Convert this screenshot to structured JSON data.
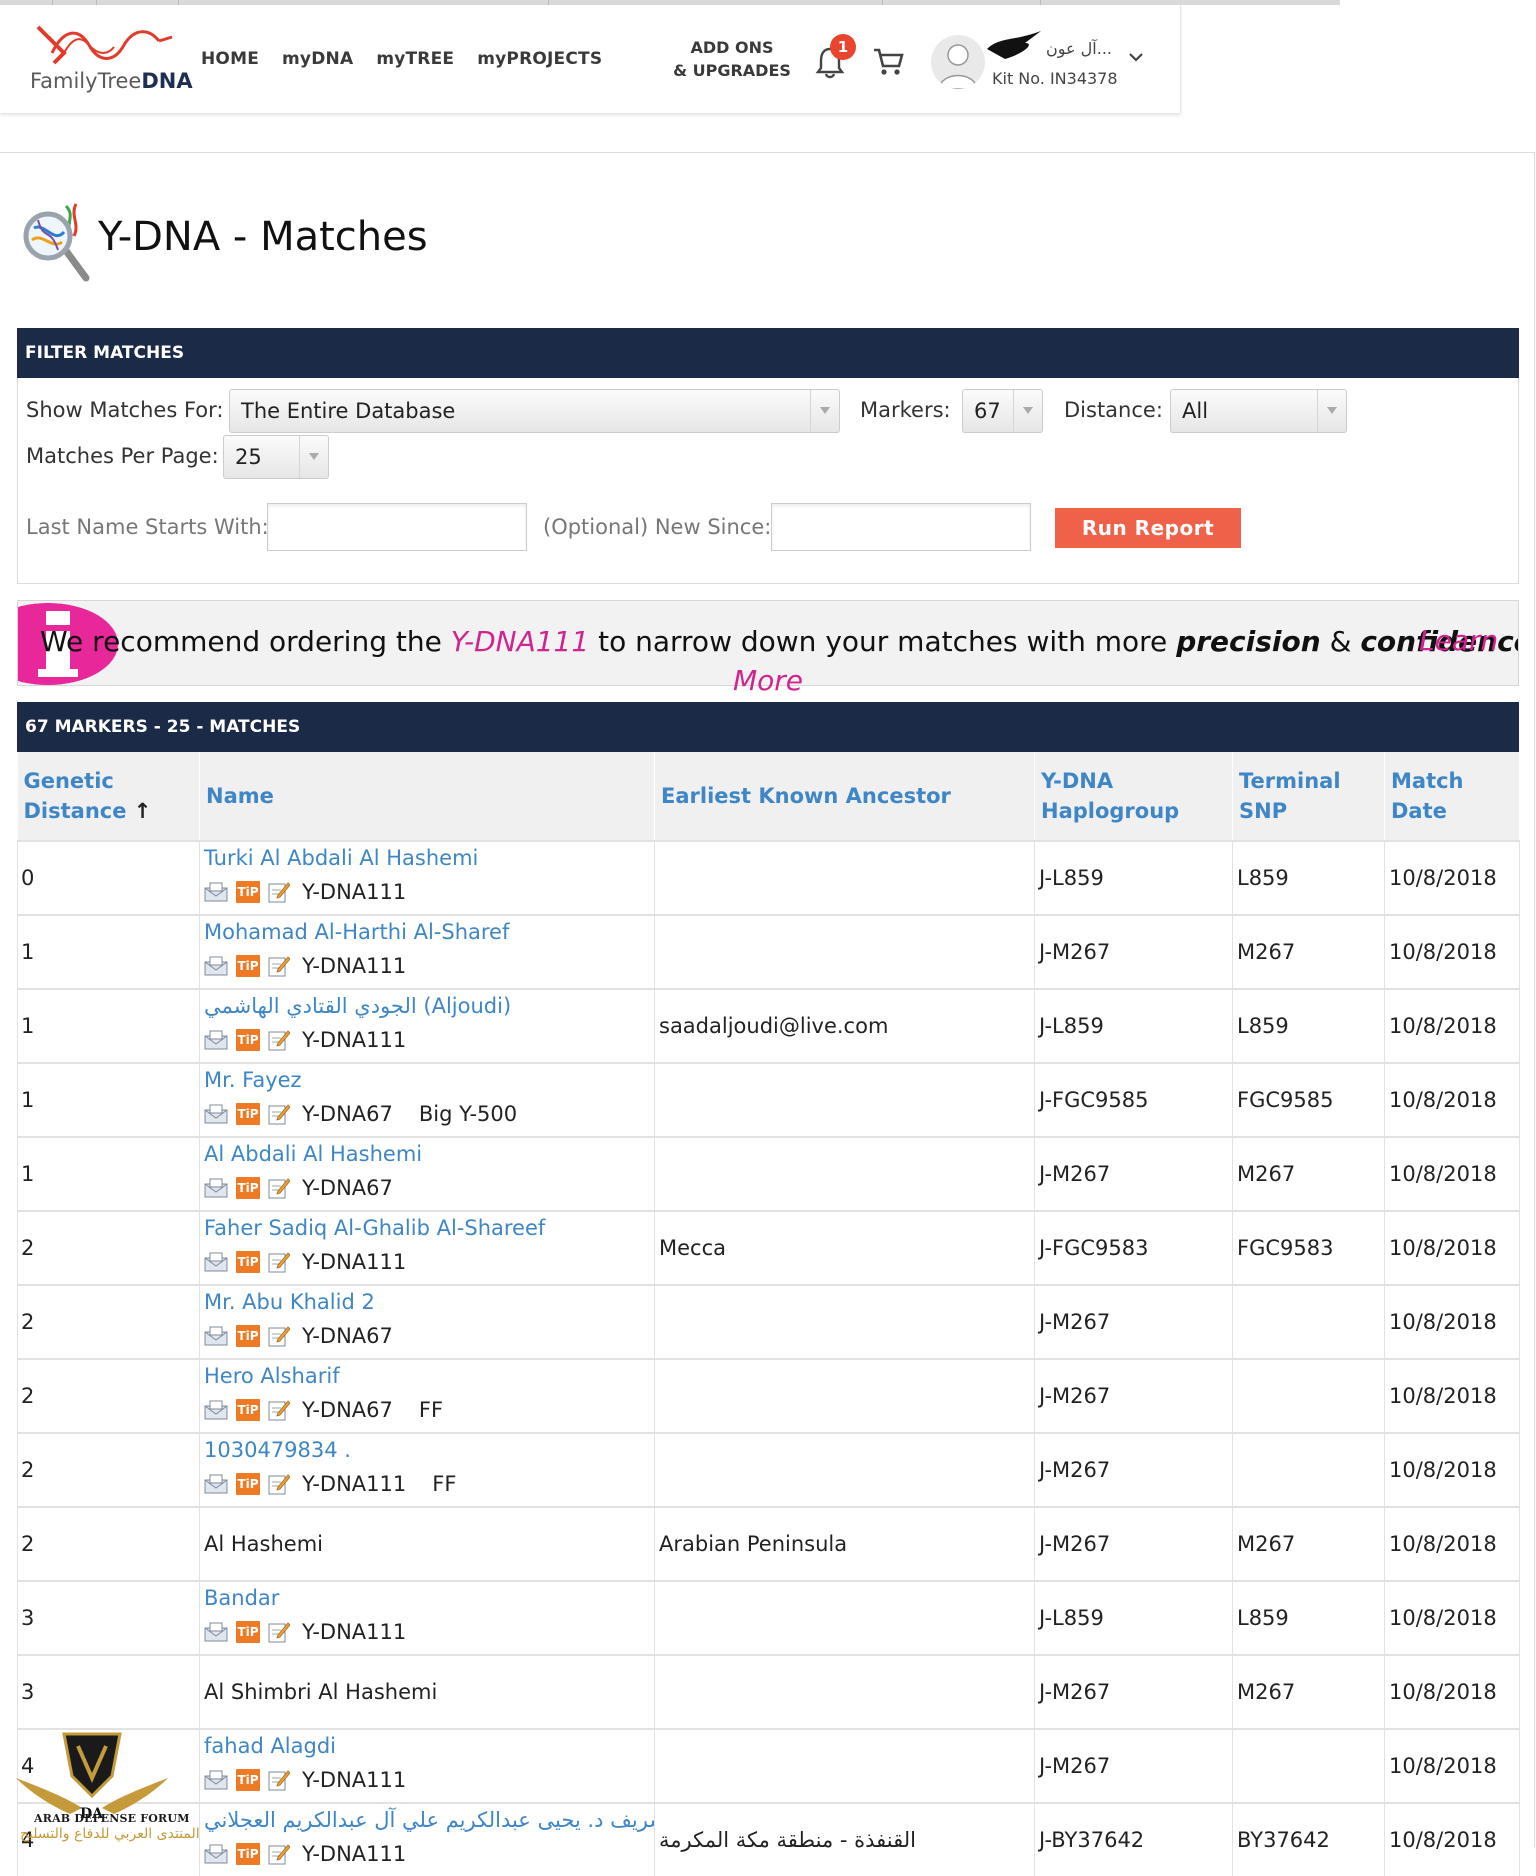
{
  "header": {
    "logo": {
      "word1": "FamilyTree",
      "word2": "DNA"
    },
    "nav": [
      "HOME",
      "myDNA",
      "myTREE",
      "myPROJECTS"
    ],
    "addons_line1": "ADD ONS",
    "addons_line2": "& UPGRADES",
    "notification_count": "1",
    "user_name": "...آل عون",
    "kit_number": "Kit No. IN34378"
  },
  "page": {
    "title": "Y-DNA - Matches"
  },
  "filter": {
    "heading": "FILTER MATCHES",
    "show_label": "Show Matches For:",
    "show_value": "The Entire Database",
    "markers_label": "Markers:",
    "markers_value": "67",
    "distance_label": "Distance:",
    "distance_value": "All",
    "per_page_label": "Matches Per Page:",
    "per_page_value": "25",
    "lastname_label": "Last Name Starts With:",
    "lastname_value": "",
    "newsince_label": "(Optional) New Since:",
    "newsince_value": "",
    "run_label": "Run Report"
  },
  "promo": {
    "t1": "We recommend ordering the ",
    "product": "Y-DNA111",
    "t2": " to narrow down your matches with more ",
    "w1": "precision",
    "t3": " & ",
    "w2": "confidence.",
    "learn1": "Learn",
    "learn2": "More"
  },
  "results": {
    "heading": "67 MARKERS - 25 - MATCHES",
    "headers": {
      "dist_line1": "Genetic",
      "dist_line2": "Distance",
      "sort_arrow": "↑",
      "name": "Name",
      "eka": "Earliest Known Ancestor",
      "hg_line1": "Y-DNA",
      "hg_line2": "Haplogroup",
      "snp_line1": "Terminal",
      "snp_line2": "SNP",
      "date": "Match Date"
    },
    "rows": [
      {
        "distance": "0",
        "name": "Turki Al Abdali Al Hashemi",
        "test": "Y-DNA111",
        "extra": "",
        "eka": "",
        "haplogroup": "J-L859",
        "snp": "L859",
        "date": "10/8/2018"
      },
      {
        "distance": "1",
        "name": "Mohamad Al-Harthi Al-Sharef",
        "test": "Y-DNA111",
        "extra": "",
        "eka": "",
        "haplogroup": "J-M267",
        "snp": "M267",
        "date": "10/8/2018"
      },
      {
        "distance": "1",
        "name": "الجودي القتادي الهاشمي (Aljoudi)",
        "test": "Y-DNA111",
        "extra": "",
        "eka": "saadaljoudi@live.com",
        "haplogroup": "J-L859",
        "snp": "L859",
        "date": "10/8/2018"
      },
      {
        "distance": "1",
        "name": "Mr. Fayez",
        "test": "Y-DNA67",
        "extra": "Big Y-500",
        "eka": "",
        "haplogroup": "J-FGC9585",
        "snp": "FGC9585",
        "date": "10/8/2018"
      },
      {
        "distance": "1",
        "name": "Al Abdali Al Hashemi",
        "test": "Y-DNA67",
        "extra": "",
        "eka": "",
        "haplogroup": "J-M267",
        "snp": "M267",
        "date": "10/8/2018"
      },
      {
        "distance": "2",
        "name": "Faher Sadiq Al-Ghalib Al-Shareef",
        "test": "Y-DNA111",
        "extra": "",
        "eka": "Mecca",
        "haplogroup": "J-FGC9583",
        "snp": "FGC9583",
        "date": "10/8/2018"
      },
      {
        "distance": "2",
        "name": "Mr. Abu Khalid 2",
        "test": "Y-DNA67",
        "extra": "",
        "eka": "",
        "haplogroup": "J-M267",
        "snp": "",
        "date": "10/8/2018"
      },
      {
        "distance": "2",
        "name": "Hero Alsharif",
        "test": "Y-DNA67",
        "extra": "FF",
        "eka": "",
        "haplogroup": "J-M267",
        "snp": "",
        "date": "10/8/2018"
      },
      {
        "distance": "2",
        "name": "1030479834 .",
        "test": "Y-DNA111",
        "extra": "FF",
        "eka": "",
        "haplogroup": "J-M267",
        "snp": "",
        "date": "10/8/2018"
      },
      {
        "distance": "2",
        "name": "Al Hashemi",
        "test": "",
        "extra": "",
        "eka": "Arabian Peninsula",
        "haplogroup": "J-M267",
        "snp": "M267",
        "date": "10/8/2018"
      },
      {
        "distance": "3",
        "name": "Bandar",
        "test": "Y-DNA111",
        "extra": "",
        "eka": "",
        "haplogroup": "J-L859",
        "snp": "L859",
        "date": "10/8/2018"
      },
      {
        "distance": "3",
        "name": "Al Shimbri Al Hashemi",
        "test": "",
        "extra": "",
        "eka": "",
        "haplogroup": "J-M267",
        "snp": "M267",
        "date": "10/8/2018"
      },
      {
        "distance": "4",
        "name": "fahad Alagdi",
        "test": "Y-DNA111",
        "extra": "",
        "eka": "",
        "haplogroup": "J-M267",
        "snp": "",
        "date": "10/8/2018"
      },
      {
        "distance": "4",
        "name": "الشريف د. يحيى عبدالكريم علي آل عبدالكريم العجلاني .",
        "test": "Y-DNA111",
        "extra": "",
        "eka": "القنفذة - منطقة مكة المكرمة",
        "haplogroup": "J-BY37642",
        "snp": "BY37642",
        "date": "10/8/2018"
      }
    ]
  },
  "watermark": {
    "line1": "ARAB DEFENSE FORUM",
    "line2": "المنتدى العربي للدفاع والتسليح"
  }
}
